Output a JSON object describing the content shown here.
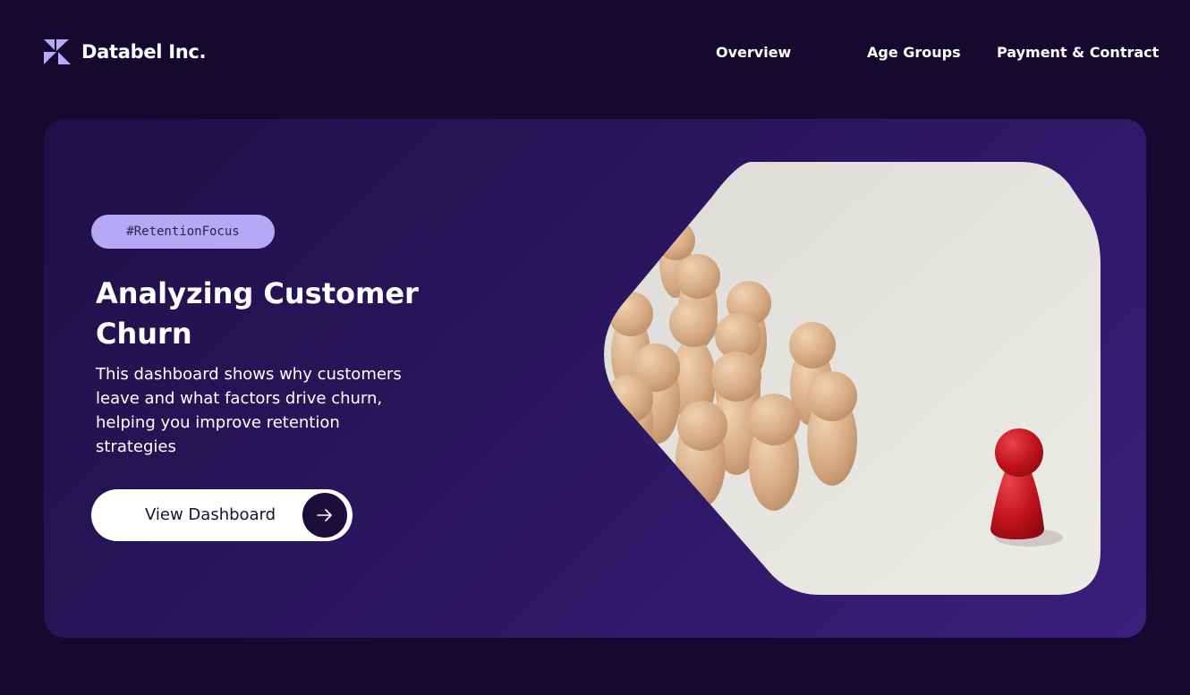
{
  "header": {
    "brand": "Databel Inc.",
    "nav": [
      {
        "label": "Overview"
      },
      {
        "label": "Age Groups"
      },
      {
        "label": "Payment & Contract"
      }
    ]
  },
  "hero": {
    "tag": "#RetentionFocus",
    "title": "Analyzing Customer Churn",
    "description": "This dashboard shows why customers leave and what factors drive churn, helping you improve retention strategies",
    "cta_label": "View Dashboard"
  },
  "colors": {
    "background": "#140a30",
    "card_gradient_start": "#1e1048",
    "card_gradient_end": "#3a1f7c",
    "tag_bg": "#b5a8f5",
    "accent_logo": "#b9a9f7",
    "figure_wood": "#d7b08c",
    "figure_red": "#c1121c"
  },
  "icons": {
    "logo": "databel-logo-icon",
    "cta": "arrow-right-icon"
  }
}
